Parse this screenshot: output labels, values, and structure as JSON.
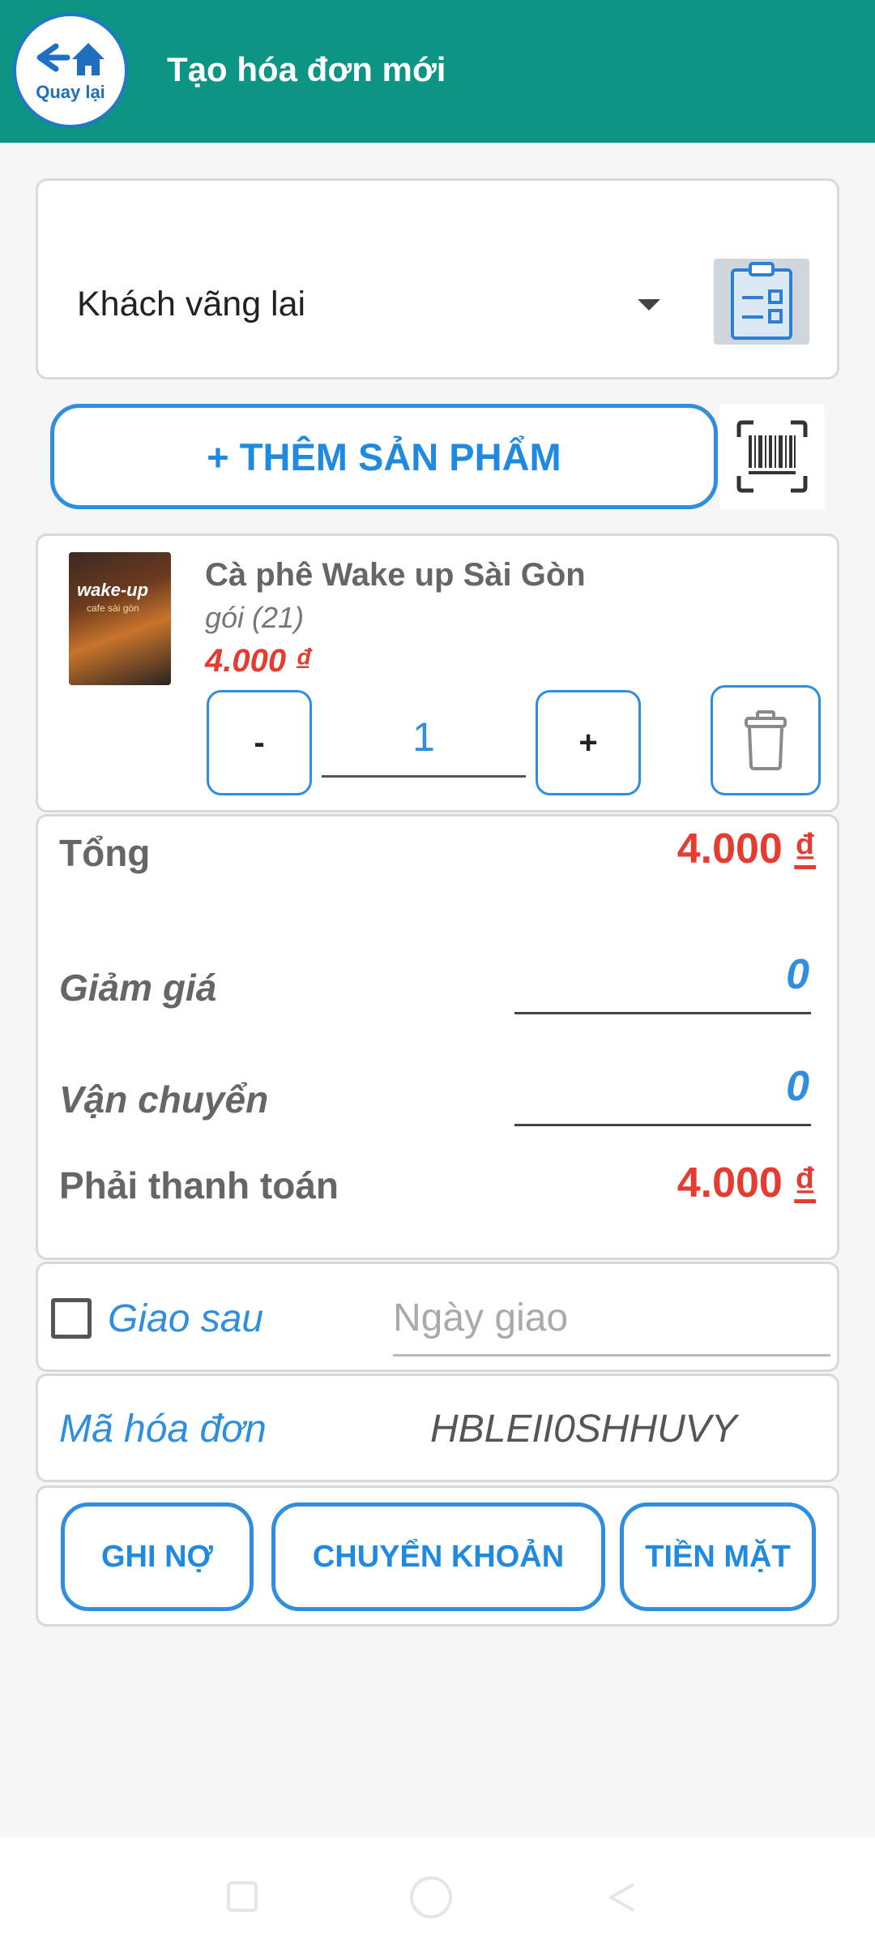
{
  "header": {
    "back_label": "Quay lại",
    "title": "Tạo hóa đơn mới"
  },
  "customer": {
    "selected": "Khách vãng lai"
  },
  "actions": {
    "add_product_label": "+ THÊM SẢN PHẨM"
  },
  "cart": {
    "items": [
      {
        "image_brand": "wake-up",
        "image_sub": "cafe sài gòn",
        "name": "Cà phê Wake up Sài Gòn",
        "unit": "gói (21)",
        "price": "4.000 ₫",
        "quantity": "1",
        "minus_label": "-",
        "plus_label": "+"
      }
    ]
  },
  "summary": {
    "total_label": "Tổng",
    "total_value": "4.000",
    "currency": "₫",
    "discount_label": "Giảm giá",
    "discount_value": "0",
    "shipping_label": "Vận chuyển",
    "shipping_value": "0",
    "payable_label": "Phải thanh toán",
    "payable_value": "4.000"
  },
  "delivery": {
    "label": "Giao sau",
    "date_placeholder": "Ngày giao",
    "checked": false
  },
  "invoice": {
    "label": "Mã hóa đơn",
    "code": "HBLEII0SHHUVY"
  },
  "payment": {
    "debt_label": "GHI NỢ",
    "transfer_label": "CHUYỂN KHOẢN",
    "cash_label": "TIỀN MẶT"
  },
  "colors": {
    "header_bg": "#0e9484",
    "accent": "#2f8ee0",
    "price_red": "#e53b30"
  },
  "icons": [
    "back-home-icon",
    "dropdown-arrow-icon",
    "clipboard-list-icon",
    "barcode-scan-icon",
    "trash-icon",
    "nav-recents-icon",
    "nav-home-icon",
    "nav-back-icon"
  ]
}
